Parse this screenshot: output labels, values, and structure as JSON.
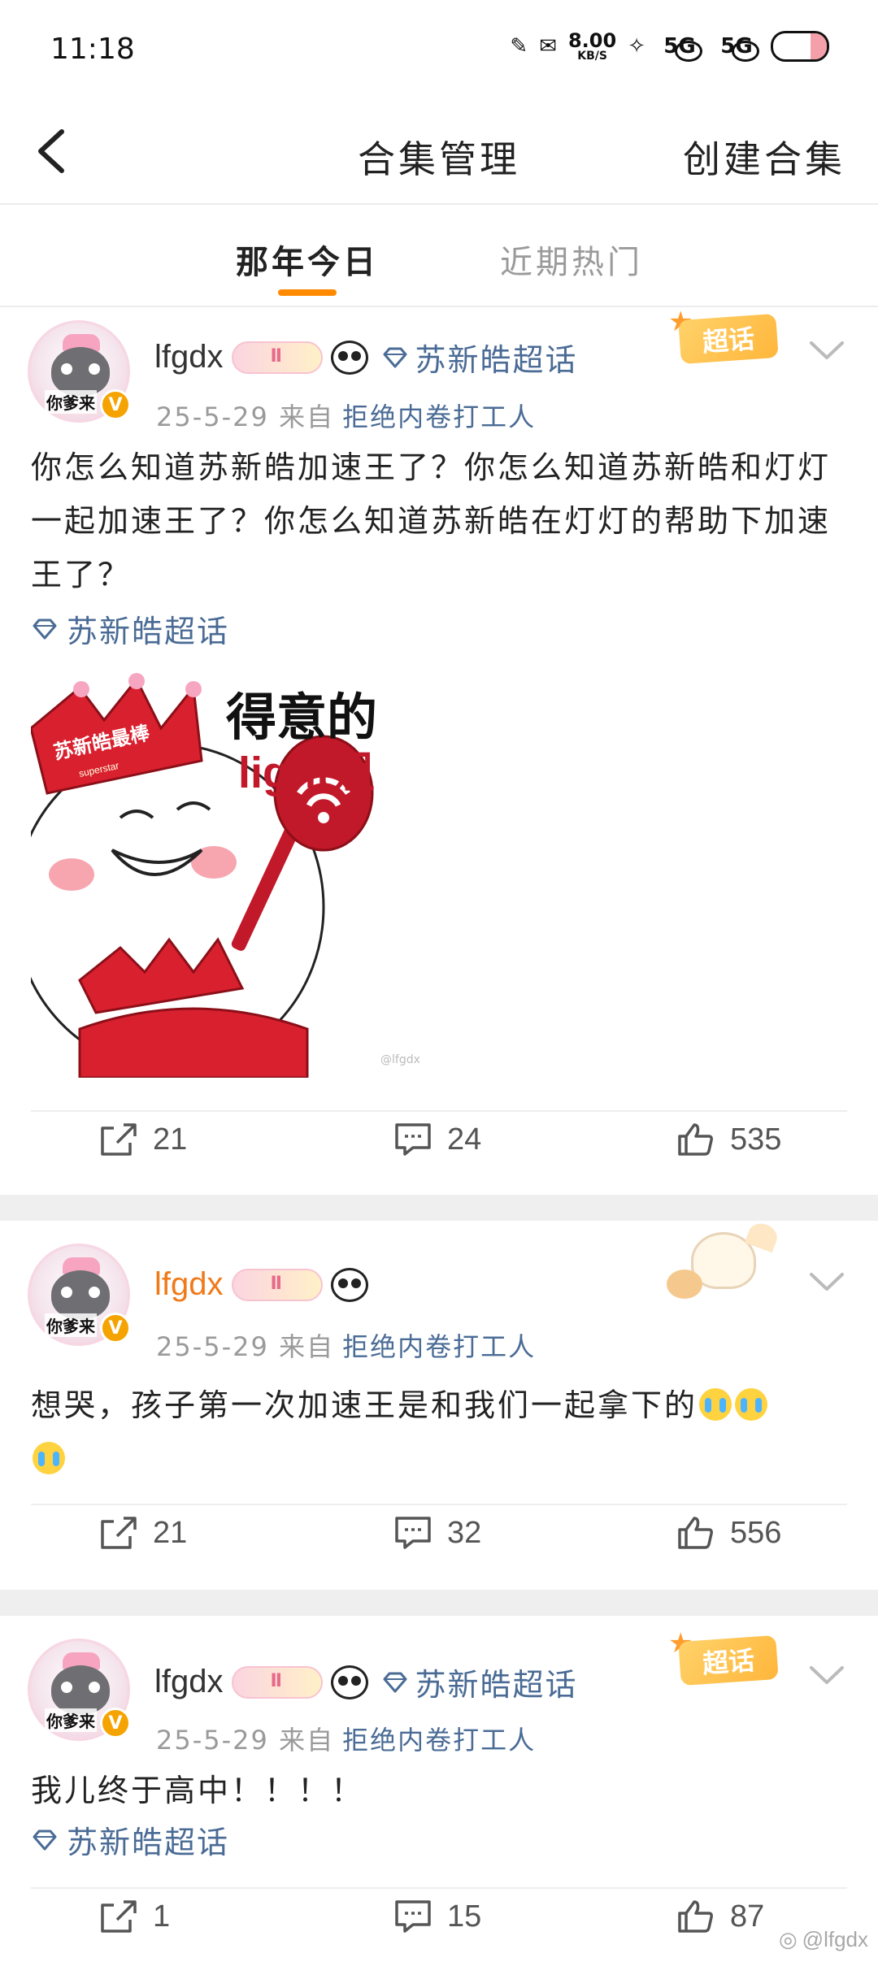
{
  "status_bar": {
    "time": "11:18",
    "net_speed_value": "8.00",
    "net_speed_unit": "KB/S",
    "signal1": "5G",
    "signal2": "5G"
  },
  "header": {
    "title": "合集管理",
    "action": "创建合集"
  },
  "tabs": [
    {
      "label": "那年今日",
      "active": true
    },
    {
      "label": "近期热门",
      "active": false
    }
  ],
  "posts": [
    {
      "username": "lfgdx",
      "avatar_tag": "你爹来",
      "topic_inline": "苏新皓超话",
      "badge": "超话",
      "date": "25-5-29",
      "source_prefix": "来自",
      "source": "拒绝内卷打工人",
      "text": "你怎么知道苏新皓加速王了？你怎么知道苏新皓和灯灯一起加速王了？你怎么知道苏新皓在灯灯的帮助下加速王了？",
      "topic_link": "苏新皓超话",
      "image": {
        "caption_line1": "得意的",
        "caption_line2": "light姐",
        "crown_text": "苏新皓最棒",
        "crown_subtext": "superstar",
        "watermark": "@lfgdx"
      },
      "reposts": "21",
      "comments": "24",
      "likes": "535"
    },
    {
      "username": "lfgdx",
      "avatar_tag": "你爹来",
      "date": "25-5-29",
      "source_prefix": "来自",
      "source": "拒绝内卷打工人",
      "text": "想哭，孩子第一次加速王是和我们一起拿下的",
      "reposts": "21",
      "comments": "32",
      "likes": "556"
    },
    {
      "username": "lfgdx",
      "avatar_tag": "你爹来",
      "topic_inline": "苏新皓超话",
      "badge": "超话",
      "date": "25-5-29",
      "source_prefix": "来自",
      "source": "拒绝内卷打工人",
      "text": "我儿终于高中！！！！",
      "topic_link": "苏新皓超话",
      "reposts": "1",
      "comments": "15",
      "likes": "87"
    }
  ],
  "watermark": "@lfgdx",
  "colors": {
    "accent": "#ff8a00",
    "link": "#4a6b95",
    "vip_name": "#f07a1a",
    "divider": "#efefef"
  }
}
